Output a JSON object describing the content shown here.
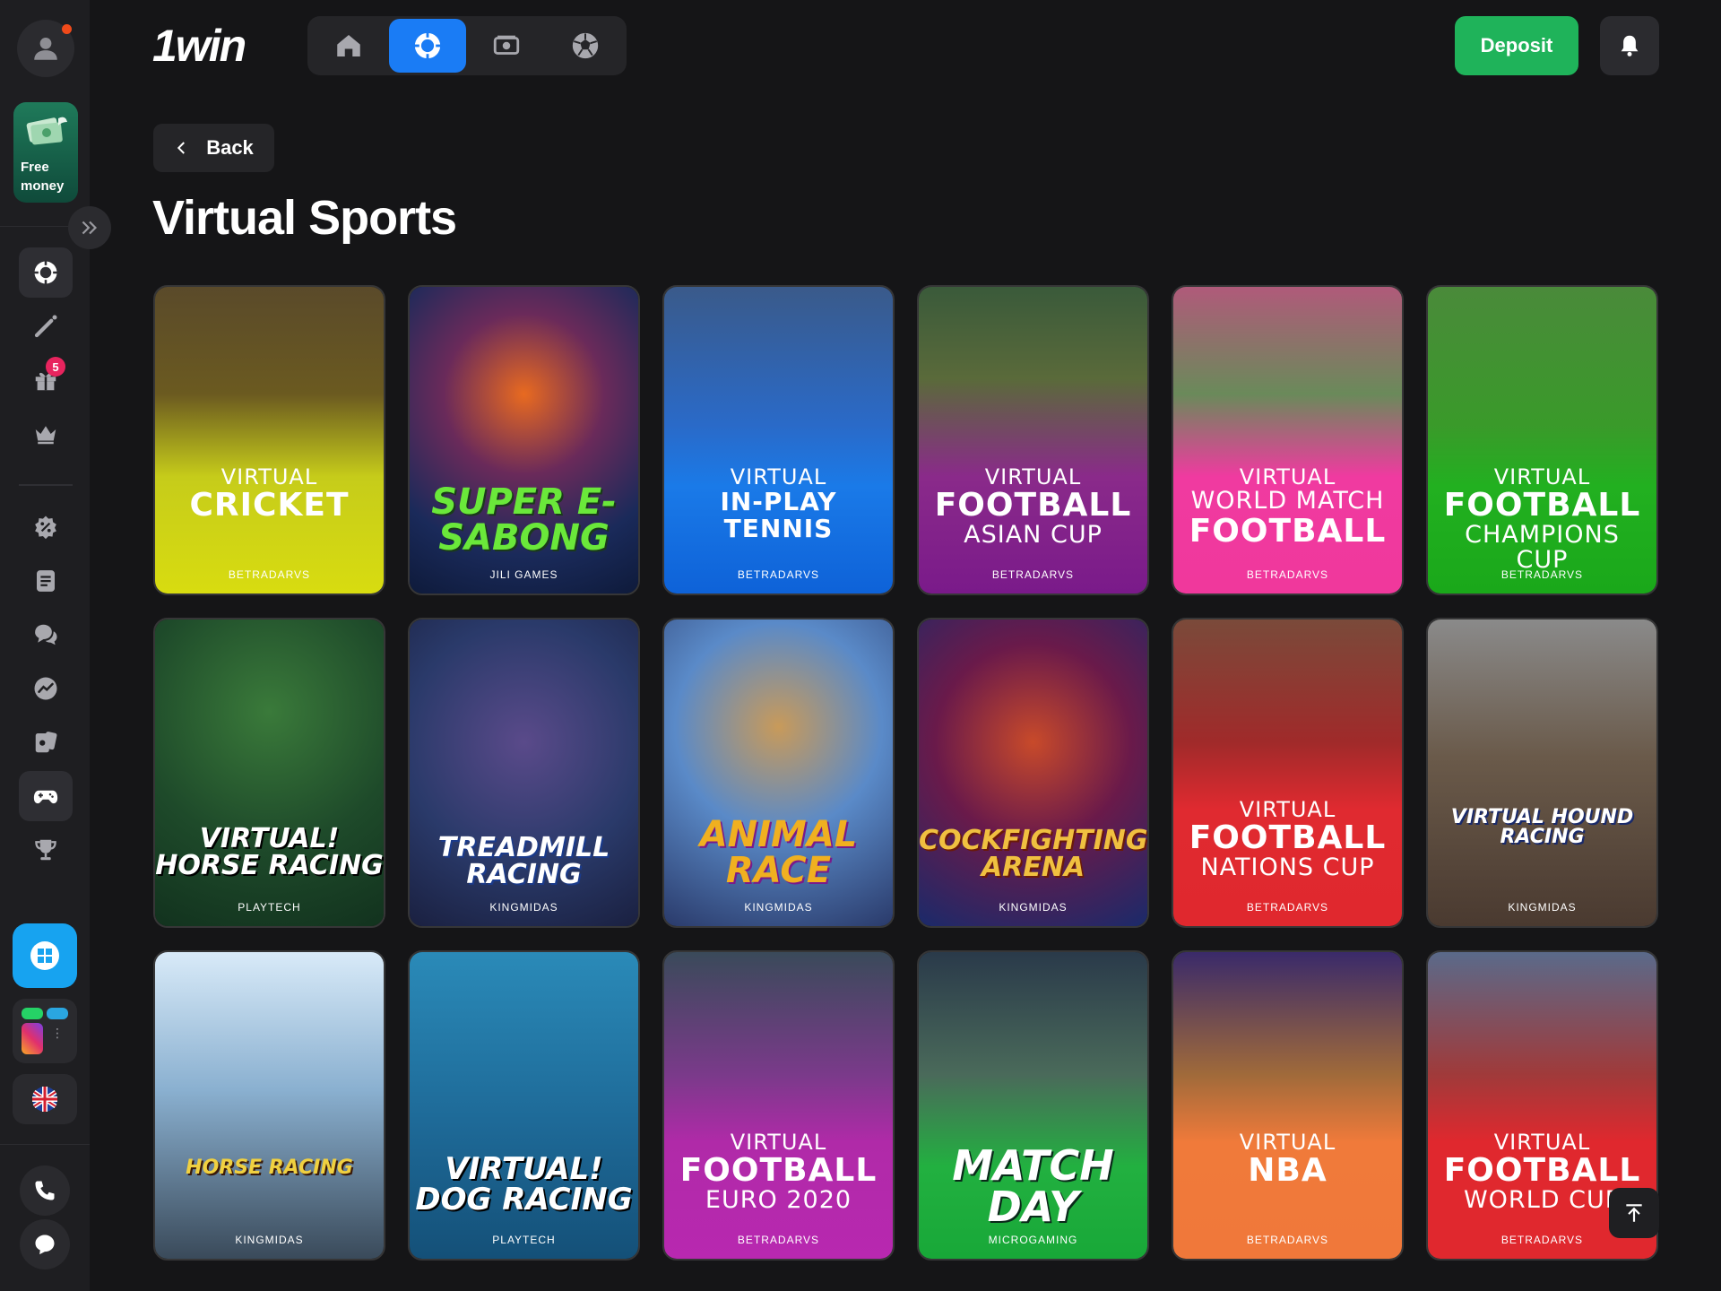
{
  "header": {
    "logo": "1win",
    "deposit_label": "Deposit",
    "nav": [
      {
        "icon": "home-icon"
      },
      {
        "icon": "chip-icon",
        "active": true
      },
      {
        "icon": "money-icon"
      },
      {
        "icon": "soccer-ball-icon"
      }
    ]
  },
  "sidebar": {
    "free_money_label": "Free money",
    "gift_badge": "5"
  },
  "page": {
    "back_label": "Back",
    "title": "Virtual Sports"
  },
  "games": [
    {
      "name": "cricket",
      "s": "VIRTUAL",
      "b": "CRICKET",
      "m": "",
      "provider": "BETRADARVS",
      "style": "cricket"
    },
    {
      "name": "super-e-sabong",
      "logo": "SUPER E-SABONG",
      "provider": "JILI GAMES",
      "style": "sabong"
    },
    {
      "name": "in-play-tennis",
      "s": "VIRTUAL",
      "b": "IN-PLAY TENNIS",
      "m": "",
      "provider": "BETRADARVS",
      "style": "tennis"
    },
    {
      "name": "football-asian-cup",
      "s": "VIRTUAL",
      "b": "FOOTBALL",
      "m": "ASIAN CUP",
      "provider": "BETRADARVS",
      "style": "asian"
    },
    {
      "name": "world-match-football",
      "s": "VIRTUAL",
      "b": "FOOTBALL",
      "m": "WORLD MATCH",
      "provider": "BETRADARVS",
      "style": "world"
    },
    {
      "name": "football-champions-cup",
      "s": "VIRTUAL",
      "b": "FOOTBALL",
      "m": "CHAMPIONS CUP",
      "provider": "BETRADARVS",
      "style": "champions"
    },
    {
      "name": "horse-racing-playtech",
      "logo": "VIRTUAL! HORSE RACING",
      "provider": "PLAYTECH",
      "style": "horsept"
    },
    {
      "name": "treadmill-racing",
      "logo": "TREADMILL RACING",
      "provider": "KINGMIDAS",
      "style": "treadmill"
    },
    {
      "name": "animal-race",
      "logo": "ANIMAL RACE",
      "provider": "KINGMIDAS",
      "style": "animal"
    },
    {
      "name": "cockfighting-arena",
      "logo": "COCKFIGHTING ARENA",
      "provider": "KINGMIDAS",
      "style": "cock"
    },
    {
      "name": "football-nations-cup",
      "s": "VIRTUAL",
      "b": "FOOTBALL",
      "m": "NATIONS CUP",
      "provider": "BETRADARVS",
      "style": "nations"
    },
    {
      "name": "hound-racing",
      "logo": "VIRTUAL HOUND RACING",
      "provider": "KINGMIDAS",
      "style": "hound"
    },
    {
      "name": "horse-racing-kingmidas",
      "logo": "HORSE RACING",
      "provider": "KINGMIDAS",
      "style": "horsekm"
    },
    {
      "name": "dog-racing",
      "logo": "VIRTUAL! DOG RACING",
      "provider": "PLAYTECH",
      "style": "dog"
    },
    {
      "name": "football-euro-2020",
      "s": "VIRTUAL",
      "b": "FOOTBALL",
      "m": "EURO 2020",
      "provider": "BETRADARVS",
      "style": "euro"
    },
    {
      "name": "match-day",
      "logo": "MATCH DAY",
      "provider": "MICROGAMING",
      "style": "matchday"
    },
    {
      "name": "nba",
      "s": "VIRTUAL",
      "b": "NBA",
      "m": "",
      "provider": "BETRADARVS",
      "style": "nba"
    },
    {
      "name": "football-world-cup",
      "s": "VIRTUAL",
      "b": "FOOTBALL",
      "m": "WORLD CUP",
      "provider": "BETRADARVS",
      "style": "worldcup"
    }
  ],
  "colors": {
    "accent": "#1a7cf5",
    "deposit": "#1fb35a",
    "background": "#151517",
    "sidebar": "#1e1e21"
  }
}
